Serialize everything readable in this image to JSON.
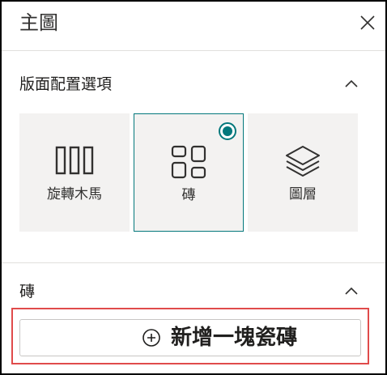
{
  "header": {
    "title": "主圖",
    "close_icon": "close-icon"
  },
  "layout_section": {
    "title": "版面配置選項",
    "collapse_icon": "chevron-up-icon",
    "options": [
      {
        "label": "旋轉木馬",
        "icon": "carousel-icon",
        "selected": false
      },
      {
        "label": "磚",
        "icon": "tiles-icon",
        "selected": true
      },
      {
        "label": "圖層",
        "icon": "layers-icon",
        "selected": false
      }
    ]
  },
  "tiles_section": {
    "title": "磚",
    "collapse_icon": "chevron-up-icon",
    "add_button_label": "新增一塊瓷磚",
    "add_icon": "add-circle-icon"
  },
  "colors": {
    "accent": "#03787c",
    "highlight": "#e04b4b",
    "option_bg": "#f3f2f1"
  }
}
